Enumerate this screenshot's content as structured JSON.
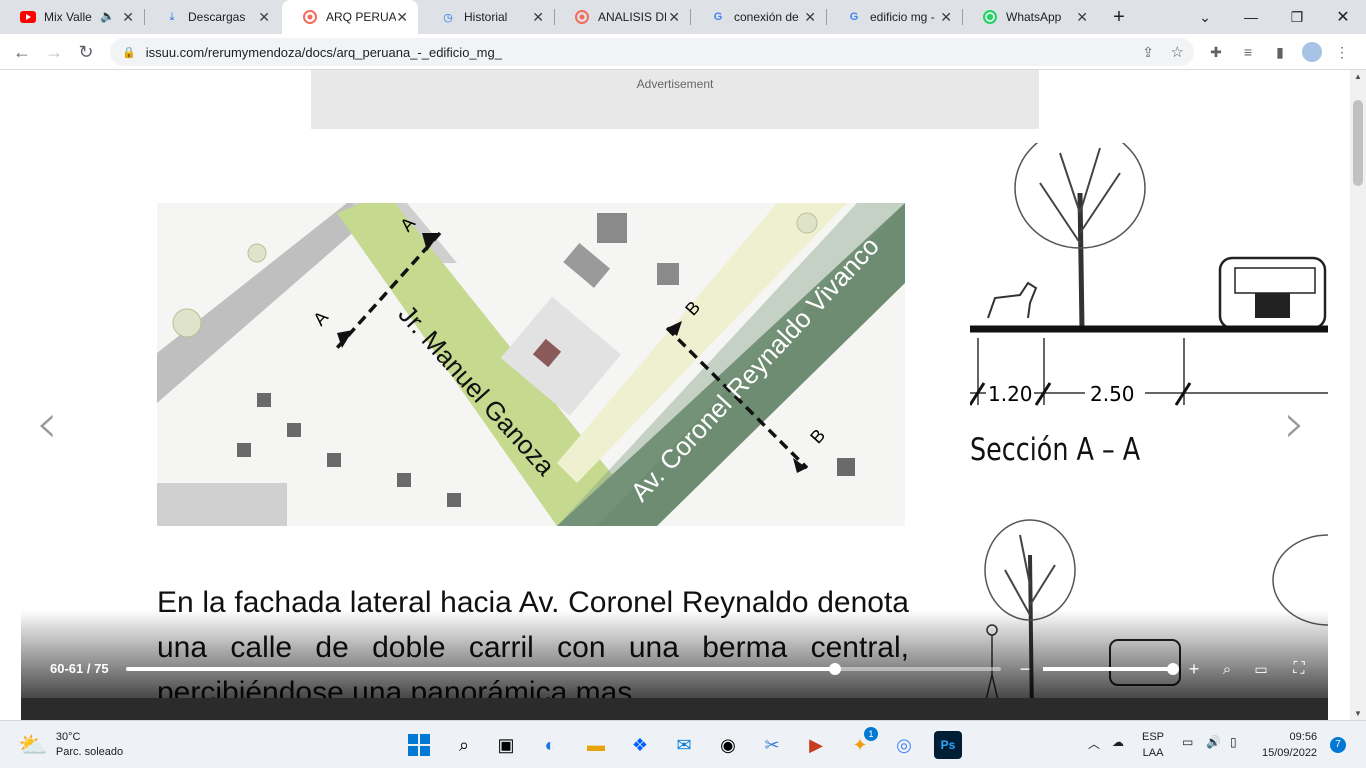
{
  "tabs": [
    {
      "label": "Mix Valle",
      "icon": "youtube-icon",
      "audio": true
    },
    {
      "label": "Descargas",
      "icon": "download-icon"
    },
    {
      "label": "ARQ PERUAN",
      "icon": "issuu-icon",
      "active": true
    },
    {
      "label": "Historial",
      "icon": "history-icon"
    },
    {
      "label": "ANALISIS DE",
      "icon": "issuu-icon"
    },
    {
      "label": "conexión de",
      "icon": "google-icon"
    },
    {
      "label": "edificio mg -",
      "icon": "google-icon"
    },
    {
      "label": "WhatsApp",
      "icon": "whatsapp-icon"
    }
  ],
  "toolbar": {
    "url": "issuu.com/rerumymendoza/docs/arq_peruana_-_edificio_mg_"
  },
  "page": {
    "ad_label": "Advertisement",
    "map": {
      "street1": "Jr. Manuel Ganoza",
      "street2": "Av. Coronel Reynaldo Vivanco",
      "markA": "A",
      "markB": "B"
    },
    "section_title": "Sección A – A",
    "dims": [
      "1.20",
      "2.50"
    ],
    "body_text": "En la fachada lateral hacia Av. Coronel Reynaldo denota una calle de doble carril con una berma central, percibiéndose una panorámica mas"
  },
  "reader": {
    "page_indicator": "60-61 / 75",
    "progress": 0.81,
    "zoom": 1.0
  },
  "taskbar": {
    "weather_temp": "30°C",
    "weather_desc": "Parc. soleado",
    "lang_top": "ESP",
    "lang_bottom": "LAA",
    "time": "09:56",
    "date": "15/09/2022",
    "notifications": "7",
    "badge_app": "1"
  },
  "colors": {
    "tabstrip": "#dee1e6",
    "road_green": "#c5d98f",
    "avenue_green": "#6e8c72",
    "accent": "#1a73e8"
  }
}
